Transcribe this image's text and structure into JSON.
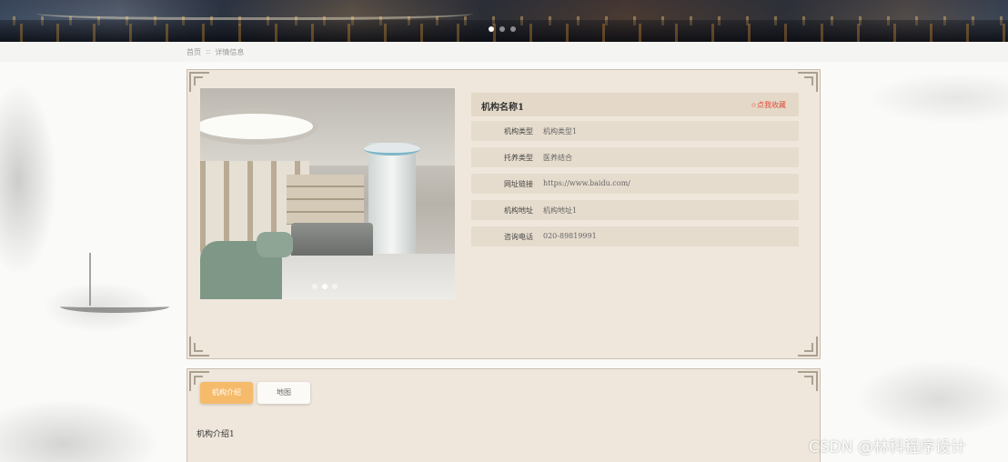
{
  "banner": {
    "slides": 3,
    "active_slide": 0
  },
  "breadcrumb": {
    "home": "首页",
    "separator": "::",
    "current": "详情信息"
  },
  "detail": {
    "name": "机构名称1",
    "favorite_label": "☆点我收藏",
    "rows": [
      {
        "label": "机构类型",
        "value": "机构类型1"
      },
      {
        "label": "托养类型",
        "value": "医养结合"
      },
      {
        "label": "网址链接",
        "value": "https://www.baidu.com/"
      },
      {
        "label": "机构地址",
        "value": "机构地址1"
      },
      {
        "label": "咨询电话",
        "value": "020-89819991"
      }
    ],
    "photo_slides": 3,
    "photo_active_slide": 1
  },
  "tabs": [
    {
      "label": "机构介绍",
      "active": true
    },
    {
      "label": "地图",
      "active": false
    }
  ],
  "intro_text": "机构介绍1",
  "watermark": "CSDN @林科程序设计",
  "colors": {
    "panel_bg": "#efe7dc",
    "tab_active": "#f5bb6a",
    "favorite": "#e34a3a"
  }
}
